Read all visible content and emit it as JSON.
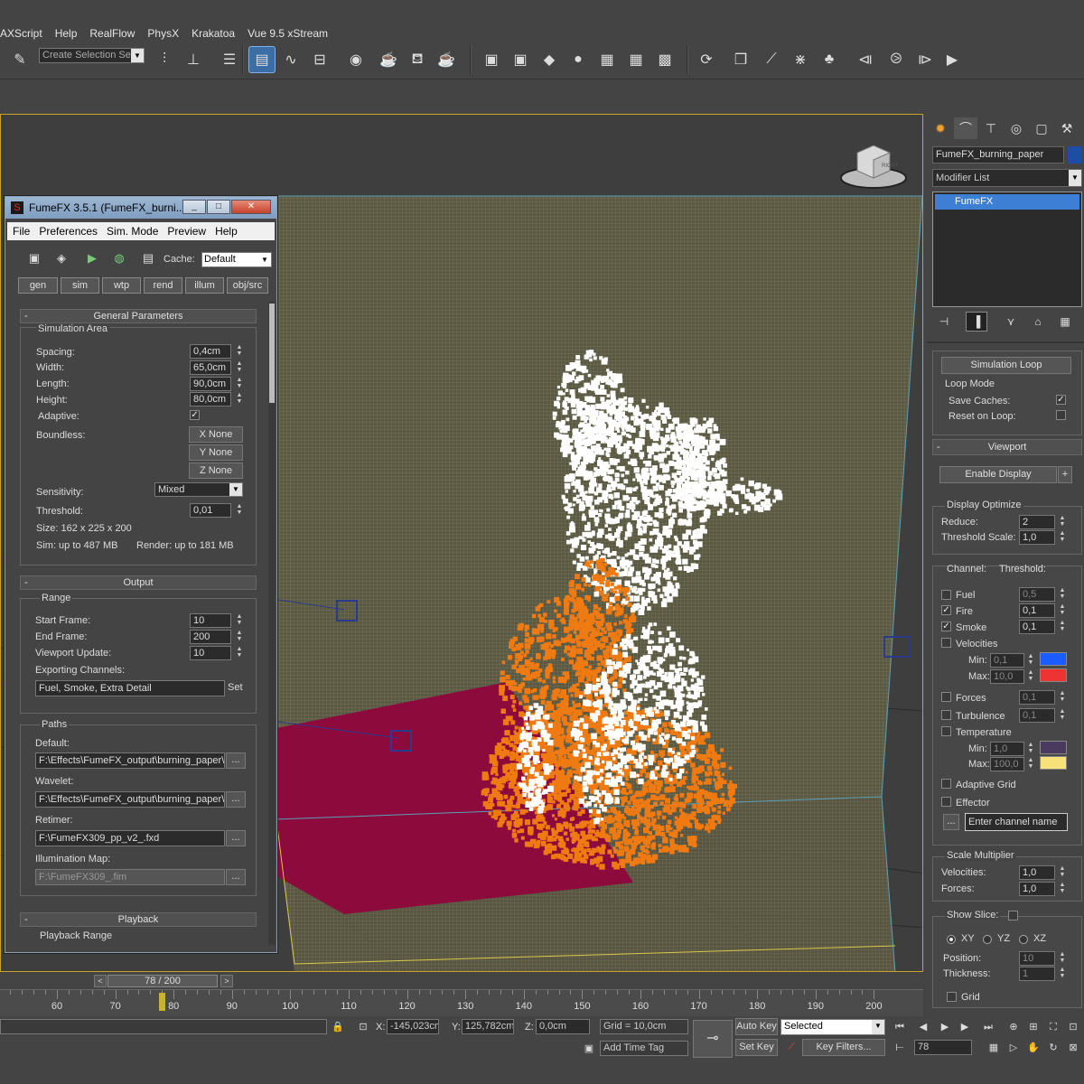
{
  "menubar": {
    "items": [
      "AXScript",
      "Help",
      "RealFlow",
      "PhysX",
      "Krakatoa",
      "Vue 9.5 xStream"
    ]
  },
  "toolbar": {
    "selection_set_placeholder": "Create Selection Se",
    "icons": [
      "snap-toggle-icon",
      "mirror-icon",
      "align-icon",
      "layer-manager-icon",
      "scene-explorer-icon",
      "curve-editor-icon",
      "schematic-view-icon",
      "material-editor-icon",
      "render-setup-icon",
      "rendered-frame-icon",
      "render-icon",
      "maxwell-mxs-icon",
      "maxwell-mxs2-icon",
      "maxwell-n-icon",
      "sphere-icon",
      "maxwell-mxw-icon",
      "maxwell-mxw2-icon",
      "maxwell-bin-icon",
      "realflow-icon",
      "physx-icon",
      "krakatoa-icon",
      "vue-icon"
    ]
  },
  "viewport": {
    "nav_cube_label": "RIGHT",
    "colors": {
      "grid": "#6e6a4a",
      "floor": "#8c0a3c",
      "fire": "#f07a12",
      "smoke": "#ffffff"
    }
  },
  "fumefx": {
    "title": "FumeFX 3.5.1 (FumeFX_burni...",
    "window_buttons": [
      "_",
      "□",
      "✕"
    ],
    "menu": [
      "File",
      "Preferences",
      "Sim. Mode",
      "Preview",
      "Help"
    ],
    "cache_label": "Cache:",
    "cache_value": "Default",
    "tabs": [
      "gen",
      "sim",
      "wtp",
      "rend",
      "illum",
      "obj/src"
    ],
    "general": {
      "header": "General Parameters",
      "sim_area_label": "Simulation Area",
      "spacing_label": "Spacing:",
      "spacing": "0,4cm",
      "width_label": "Width:",
      "width": "65,0cm",
      "length_label": "Length:",
      "length": "90,0cm",
      "height_label": "Height:",
      "height": "80,0cm",
      "adaptive_label": "Adaptive:",
      "boundless_label": "Boundless:",
      "boundless_buttons": [
        "X None",
        "Y None",
        "Z None"
      ],
      "sensitivity_label": "Sensitivity:",
      "sensitivity": "Mixed",
      "threshold_label": "Threshold:",
      "threshold": "0,01",
      "size_text": "Size: 162 x 225 x 200",
      "sim_mem": "Sim: up to 487 MB",
      "render_mem": "Render: up to 181 MB"
    },
    "output": {
      "header": "Output",
      "range_label": "Range",
      "start_label": "Start Frame:",
      "start": "10",
      "end_label": "End Frame:",
      "end": "200",
      "vpupdate_label": "Viewport Update:",
      "vpupdate": "10",
      "exporting_label": "Exporting Channels:",
      "exporting": "Fuel, Smoke, Extra Detail",
      "set_label": "Set"
    },
    "paths": {
      "label": "Paths",
      "default_label": "Default:",
      "default": "F:\\Effects\\FumeFX_output\\burning_paper\\",
      "wavelet_label": "Wavelet:",
      "wavelet": "F:\\Effects\\FumeFX_output\\burning_paper\\",
      "retimer_label": "Retimer:",
      "retimer": "F:\\FumeFX309_pp_v2_.fxd",
      "illum_label": "Illumination Map:",
      "illum": "F:\\FumeFX309_.fim",
      "browse": "..."
    },
    "playback": {
      "header": "Playback",
      "range_label": "Playback Range"
    }
  },
  "cmdpanel": {
    "object_name": "FumeFX_burning_paper",
    "object_color": "#1d4ea3",
    "modifier_list": "Modifier List",
    "stack_item": "FumeFX",
    "sim_loop": {
      "button": "Simulation Loop",
      "loop_mode": "Loop Mode",
      "save_caches": "Save Caches:",
      "reset_on_loop": "Reset on Loop:"
    },
    "viewport": {
      "header": "Viewport",
      "enable_display": "Enable Display",
      "plus": "+",
      "display_optimize": "Display Optimize",
      "reduce_label": "Reduce:",
      "reduce": "2",
      "thresh_scale_label": "Threshold Scale:",
      "thresh_scale": "1,0",
      "channel_label": "Channel:",
      "threshold_label": "Threshold:",
      "fuel_label": "Fuel",
      "fuel": "0,5",
      "fire_label": "Fire",
      "fire": "0,1",
      "smoke_label": "Smoke",
      "smoke": "0,1",
      "velocities_label": "Velocities",
      "vmin_label": "Min:",
      "vmin": "0,1",
      "vmin_color": "#1a5cff",
      "vmax_label": "Max:",
      "vmax": "10,0",
      "vmax_color": "#ee3333",
      "forces_label": "Forces",
      "forces": "0,1",
      "turbulence_label": "Turbulence",
      "turbulence": "0,1",
      "temperature_label": "Temperature",
      "tmin_label": "Min:",
      "tmin": "1,0",
      "tmin_color": "#4a3a5e",
      "tmax_label": "Max:",
      "tmax": "100,0",
      "tmax_color": "#f7e27a",
      "adaptive_grid": "Adaptive Grid",
      "effector": "Effector",
      "channel_name_placeholder": "Enter channel name",
      "scale_multiplier": "Scale Multiplier",
      "svel_label": "Velocities:",
      "svel": "1,0",
      "sforces_label": "Forces:",
      "sforces": "1,0",
      "show_slice": "Show Slice:",
      "xy": "XY",
      "yz": "YZ",
      "xz": "XZ",
      "position_label": "Position:",
      "position": "10",
      "thickness_label": "Thickness:",
      "thickness": "1",
      "grid_label": "Grid"
    }
  },
  "timeline": {
    "frame_display": "78 / 200",
    "prev": "<",
    "next": ">",
    "ticks": [
      "60",
      "70",
      "80",
      "90",
      "100",
      "110",
      "120",
      "130",
      "140",
      "150",
      "160",
      "170",
      "180",
      "190",
      "200"
    ],
    "current_frame": 78
  },
  "statusbar": {
    "x_label": "X:",
    "x": "-145,023cm",
    "y_label": "Y:",
    "y": "125,782cm",
    "z_label": "Z:",
    "z": "0,0cm",
    "grid": "Grid = 10,0cm",
    "add_time_tag": "Add Time Tag",
    "auto_key": "Auto Key",
    "set_key": "Set Key",
    "selected": "Selected",
    "key_filters": "Key Filters...",
    "frame": "78"
  }
}
